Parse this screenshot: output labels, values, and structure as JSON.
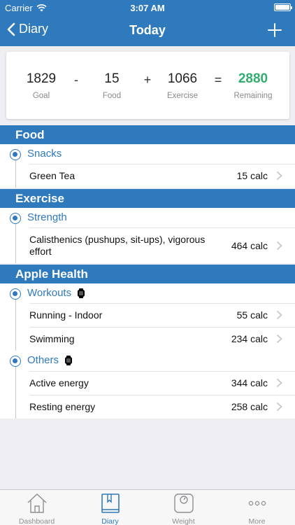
{
  "status_bar": {
    "carrier": "Carrier",
    "time": "3:07 AM"
  },
  "nav": {
    "back_label": "Diary",
    "title": "Today"
  },
  "summary": {
    "goal": {
      "value": "1829",
      "label": "Goal"
    },
    "op1": "-",
    "food": {
      "value": "15",
      "label": "Food"
    },
    "op2": "+",
    "exercise": {
      "value": "1066",
      "label": "Exercise"
    },
    "op3": "=",
    "remaining": {
      "value": "2880",
      "label": "Remaining"
    }
  },
  "sections": {
    "food": {
      "title": "Food",
      "snacks": {
        "name": "Snacks",
        "items": [
          {
            "name": "Green Tea",
            "value": "15 calc"
          }
        ]
      }
    },
    "exercise": {
      "title": "Exercise",
      "strength": {
        "name": "Strength",
        "items": [
          {
            "name": "Calisthenics (pushups, sit-ups), vigorous effort",
            "value": "464 calc"
          }
        ]
      }
    },
    "health": {
      "title": "Apple Health",
      "workouts": {
        "name": "Workouts",
        "items": [
          {
            "name": "Running - Indoor",
            "value": "55 calc"
          },
          {
            "name": "Swimming",
            "value": "234 calc"
          }
        ]
      },
      "others": {
        "name": "Others",
        "items": [
          {
            "name": "Active energy",
            "value": "344 calc"
          },
          {
            "name": "Resting energy",
            "value": "258 calc"
          }
        ]
      }
    }
  },
  "tabs": [
    {
      "label": "Dashboard",
      "icon": "house-icon"
    },
    {
      "label": "Diary",
      "icon": "book-icon"
    },
    {
      "label": "Weight",
      "icon": "scale-icon"
    },
    {
      "label": "More",
      "icon": "more-dots-icon"
    }
  ],
  "colors": {
    "accent": "#2f79bd",
    "remaining": "#2fae6e",
    "background": "#eeeef3"
  }
}
